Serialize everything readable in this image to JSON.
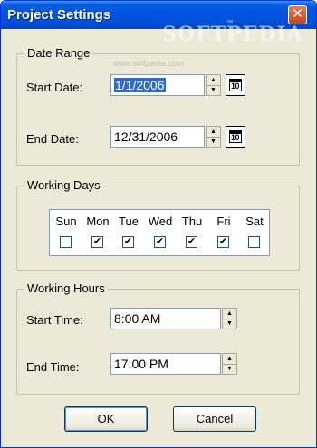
{
  "window": {
    "title": "Project Settings",
    "watermark": "SOFTPEDIA",
    "watermark_tm": "™",
    "watermark_url": "www.softpedia.com",
    "close_glyph": "✕"
  },
  "date_range": {
    "legend": "Date Range",
    "start_label": "Start Date:",
    "start_value": "1/1/2006",
    "end_label": "End Date:",
    "end_value": "12/31/2006",
    "calendar_number": "10"
  },
  "working_days": {
    "legend": "Working Days",
    "days": [
      {
        "name": "Sun",
        "checked": false
      },
      {
        "name": "Mon",
        "checked": true
      },
      {
        "name": "Tue",
        "checked": true
      },
      {
        "name": "Wed",
        "checked": true
      },
      {
        "name": "Thu",
        "checked": true
      },
      {
        "name": "Fri",
        "checked": true
      },
      {
        "name": "Sat",
        "checked": false
      }
    ]
  },
  "working_hours": {
    "legend": "Working Hours",
    "start_label": "Start Time:",
    "start_value": "8:00 AM",
    "end_label": "End Time:",
    "end_value": "17:00 PM"
  },
  "buttons": {
    "ok_label": "OK",
    "cancel_label": "Cancel"
  },
  "icons": {
    "spin_up": "▲",
    "spin_down": "▼",
    "check": "✔"
  },
  "colors": {
    "titlebar": "#0054e3",
    "dialog_bg": "#ece9d8",
    "selection": "#316ac5"
  }
}
